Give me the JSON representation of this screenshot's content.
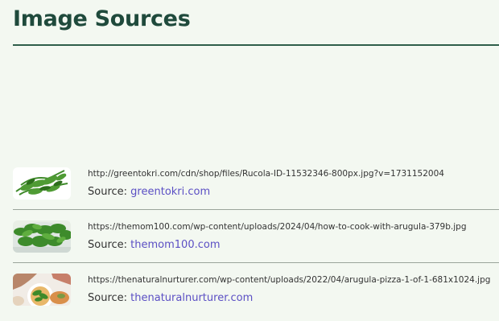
{
  "page": {
    "title": "Image Sources"
  },
  "sources": [
    {
      "url": "http://greentokri.com/cdn/shop/files/Rucola-ID-11532346-800px.jpg?v=1731152004",
      "source_label": "Source:",
      "source_name": "greentokri.com",
      "thumbnail": "arugula-bunch-image"
    },
    {
      "url": "https://themom100.com/wp-content/uploads/2024/04/how-to-cook-with-arugula-379b.jpg",
      "source_label": "Source:",
      "source_name": "themom100.com",
      "thumbnail": "arugula-salad-bowl-image"
    },
    {
      "url": "https://thenaturalnurturer.com/wp-content/uploads/2022/04/arugula-pizza-1-of-1-681x1024.jpg",
      "source_label": "Source:",
      "source_name": "thenaturalnurturer.com",
      "thumbnail": "arugula-pizza-image"
    }
  ],
  "colors": {
    "background": "#f3f8f1",
    "title": "#1f4a3c",
    "link": "#5b4fc4"
  }
}
